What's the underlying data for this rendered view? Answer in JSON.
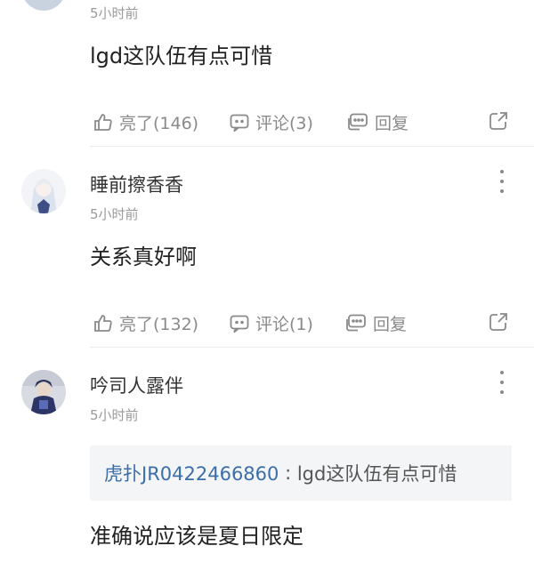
{
  "first_comment": {
    "time": "5小时前",
    "content": "lgd这队伍有点可惜",
    "like_label": "亮了(146)",
    "comment_label": "评论(3)",
    "reply_label": "回复"
  },
  "second_comment": {
    "username": "睡前擦香香",
    "time": "5小时前",
    "content": "关系真好啊",
    "like_label": "亮了(132)",
    "comment_label": "评论(1)",
    "reply_label": "回复"
  },
  "third_comment": {
    "username": "吟司人露伴",
    "time": "5小时前",
    "quote_user": "虎扑JR0422466860",
    "quote_sep": " : ",
    "quote_text": "lgd这队伍有点可惜",
    "content": "准确说应该是夏日限定"
  },
  "icons": {
    "like": "thumbs-up-icon",
    "comment": "comment-bubble-icon",
    "reply": "reply-bubble-icon",
    "share": "share-icon",
    "more": "more-vertical-icon"
  }
}
